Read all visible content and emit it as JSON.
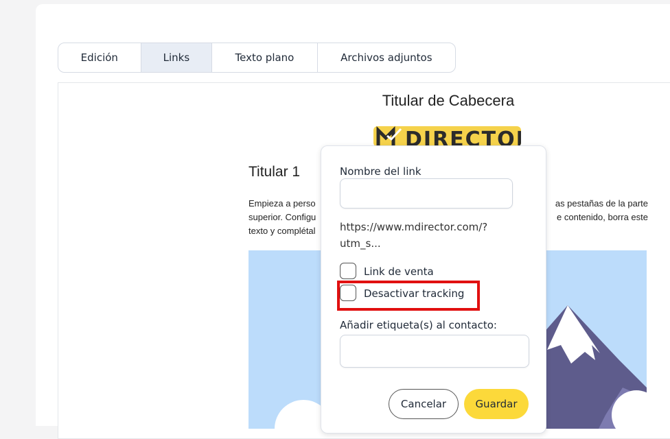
{
  "tabs": [
    {
      "label": "Edición",
      "active": false
    },
    {
      "label": "Links",
      "active": true
    },
    {
      "label": "Texto plano",
      "active": false
    },
    {
      "label": "Archivos adjuntos",
      "active": false
    }
  ],
  "email": {
    "header_title": "Titular de Cabecera",
    "logo_text": "DIRECTOR",
    "section_title": "Titular 1",
    "body_lines": [
      "Empieza a perso",
      "as pestañas de la parte",
      "superior. Configu",
      "e contenido, borra este",
      "texto y complétal"
    ]
  },
  "link_popup": {
    "name_label": "Nombre del link",
    "name_value": "",
    "url_text_line1": "https://www.mdirector.com/?",
    "url_text_line2": "utm_s...",
    "sale_link_label": "Link de venta",
    "sale_link_checked": false,
    "disable_tracking_label": "Desactivar tracking",
    "disable_tracking_checked": false,
    "tags_label": "Añadir etiqueta(s) al contacto:",
    "tags_value": "",
    "cancel_label": "Cancelar",
    "save_label": "Guardar"
  },
  "colors": {
    "accent_yellow": "#fcd93a",
    "highlight_red": "#e11010",
    "active_tab_bg": "#e8edf5",
    "hero_sky": "#bcdcfb",
    "mountain": "#5e5c8c"
  }
}
